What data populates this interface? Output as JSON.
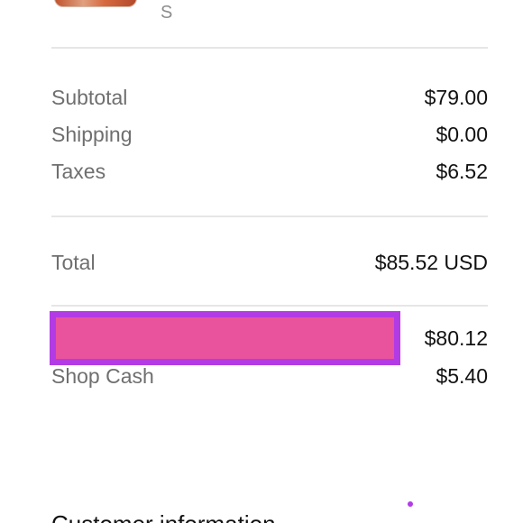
{
  "product": {
    "variant": "S"
  },
  "summary": {
    "subtotal": {
      "label": "Subtotal",
      "value": "$79.00"
    },
    "shipping": {
      "label": "Shipping",
      "value": "$0.00"
    },
    "taxes": {
      "label": "Taxes",
      "value": "$6.52"
    },
    "total": {
      "label": "Total",
      "value": "$85.52 USD"
    },
    "redacted_line": {
      "value": "$80.12"
    },
    "shop_cash": {
      "label": "Shop Cash",
      "value": "$5.40"
    }
  },
  "sections": {
    "customer_information": "Customer information"
  },
  "colors": {
    "redaction_fill": "#e9539d",
    "redaction_border": "#b33be6"
  }
}
